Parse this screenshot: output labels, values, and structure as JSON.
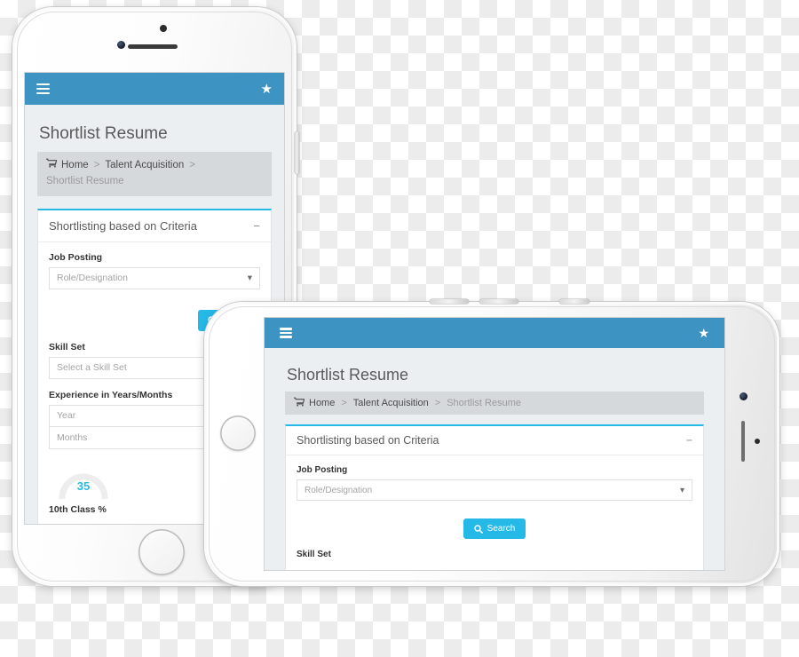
{
  "theme": {
    "navbar_blue": "#3d93c2",
    "accent_cyan": "#25b9e8",
    "screen_bg": "#eceff1",
    "breadcrumb_bg": "#d6d9db",
    "card_bg": "#ffffff"
  },
  "app": {
    "navbar": {
      "menu_icon": "hamburger-icon",
      "favorite_icon": "star-icon",
      "menu_label": "Menu",
      "favorite_label": "Favorite"
    },
    "page_title": "Shortlist Resume",
    "breadcrumb": {
      "home_icon": "cart-icon",
      "items": [
        {
          "label": "Home",
          "active": false
        },
        {
          "label": "Talent Acquisition",
          "active": false
        },
        {
          "label": "Shortlist Resume",
          "active": true
        }
      ],
      "separator": ">"
    },
    "card": {
      "title": "Shortlisting based on Criteria",
      "collapse_icon": "minus-icon",
      "collapse_glyph": "−"
    },
    "fields": {
      "job_posting_label": "Job Posting",
      "job_posting_value": "Role/Designation",
      "job_posting_caret": "▾",
      "skill_set_label": "Skill Set",
      "skill_set_placeholder": "Select a Skill Set",
      "experience_label": "Experience in Years/Months",
      "year_placeholder": "Year",
      "months_placeholder": "Months"
    },
    "search_button": {
      "label": "Search",
      "icon": "search-icon"
    },
    "gauge": {
      "value": "35",
      "caption": "10th Class %",
      "max": "100",
      "track_color": "#ededed",
      "value_color": "#25b9e8"
    }
  },
  "devices": [
    {
      "name": "phone-portrait",
      "orientation": "portrait",
      "hardware": [
        "front-camera",
        "earpiece-speaker",
        "proximity-sensor",
        "home-button",
        "power-button"
      ]
    },
    {
      "name": "phone-landscape",
      "orientation": "landscape",
      "hardware": [
        "front-camera",
        "earpiece-speaker",
        "proximity-sensor",
        "home-button",
        "volume-up-button",
        "volume-down-button",
        "ringer-switch"
      ]
    }
  ]
}
